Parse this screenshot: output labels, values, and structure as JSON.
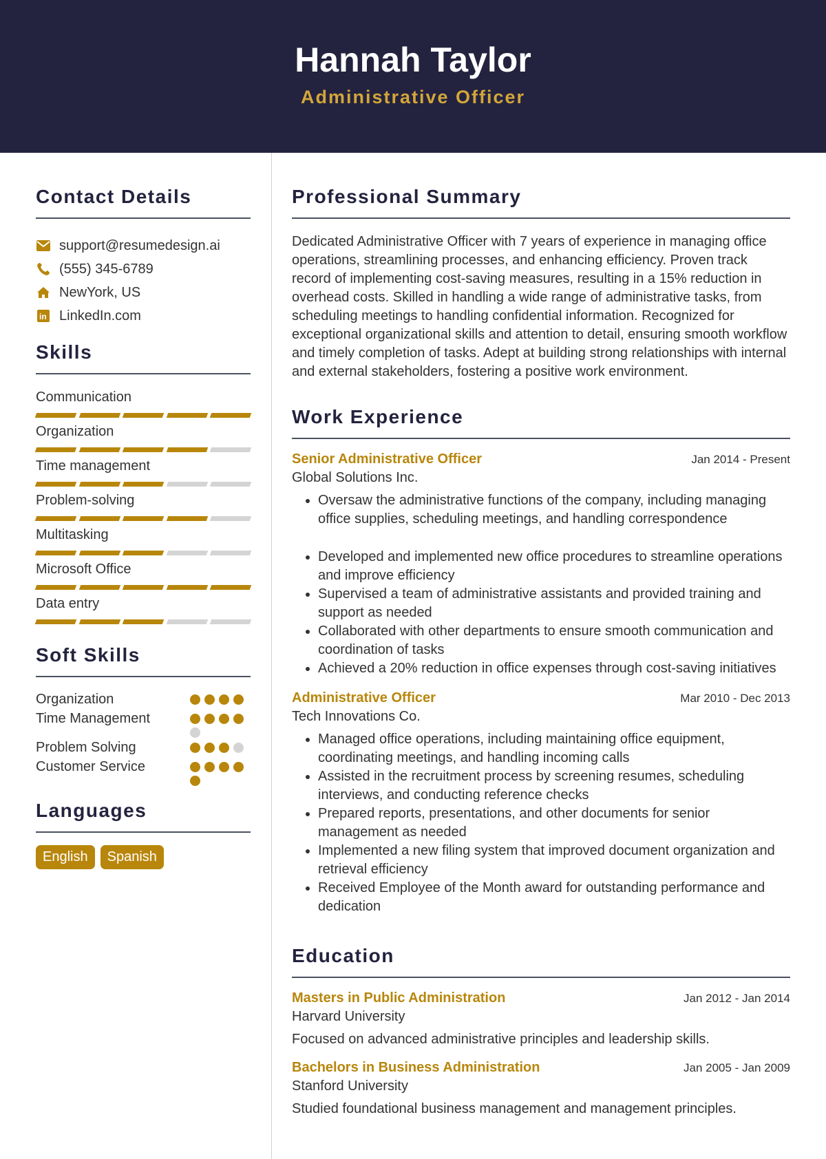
{
  "header": {
    "name": "Hannah Taylor",
    "role": "Administrative Officer"
  },
  "colors": {
    "header_bg": "#23233f",
    "accent": "#b8860b",
    "role_text": "#d4a63a",
    "inactive": "#d4d4d4"
  },
  "contact": {
    "title": "Contact Details",
    "items": [
      {
        "icon": "envelope-icon",
        "text": "support@resumedesign.ai"
      },
      {
        "icon": "phone-icon",
        "text": "(555) 345-6789"
      },
      {
        "icon": "home-icon",
        "text": "NewYork, US"
      },
      {
        "icon": "linkedin-icon",
        "text": "LinkedIn.com"
      }
    ]
  },
  "skills": {
    "title": "Skills",
    "items": [
      {
        "name": "Communication",
        "level": 5,
        "max": 5
      },
      {
        "name": "Organization",
        "level": 4,
        "max": 5
      },
      {
        "name": "Time management",
        "level": 3,
        "max": 5
      },
      {
        "name": "Problem-solving",
        "level": 4,
        "max": 5
      },
      {
        "name": "Multitasking",
        "level": 3,
        "max": 5
      },
      {
        "name": "Microsoft Office",
        "level": 5,
        "max": 5
      },
      {
        "name": "Data entry",
        "level": 3,
        "max": 5
      }
    ]
  },
  "soft_skills": {
    "title": "Soft Skills",
    "items": [
      {
        "name": "Organization",
        "level": 4,
        "max": 4
      },
      {
        "name": "Time Management",
        "level": 4,
        "max": 5
      },
      {
        "name": "Problem Solving",
        "level": 3,
        "max": 4
      },
      {
        "name": "Customer Service",
        "level": 5,
        "max": 5
      }
    ]
  },
  "languages": {
    "title": "Languages",
    "items": [
      "English",
      "Spanish"
    ]
  },
  "summary": {
    "title": "Professional Summary",
    "text": "Dedicated Administrative Officer with 7 years of experience in managing office operations, streamlining processes, and enhancing efficiency. Proven track record of implementing cost-saving measures, resulting in a 15% reduction in overhead costs. Skilled in handling a wide range of administrative tasks, from scheduling meetings to handling confidential information. Recognized for exceptional organizational skills and attention to detail, ensuring smooth workflow and timely completion of tasks. Adept at building strong relationships with internal and external stakeholders, fostering a positive work environment."
  },
  "experience": {
    "title": "Work Experience",
    "jobs": [
      {
        "title": "Senior Administrative Officer",
        "dates": "Jan 2014 - Present",
        "org": "Global Solutions Inc.",
        "bullets": [
          "Oversaw the administrative functions of the company, including managing office supplies, scheduling meetings, and handling correspondence",
          "Developed and implemented new office procedures to streamline operations and improve efficiency",
          "Supervised a team of administrative assistants and provided training and support as needed",
          "Collaborated with other departments to ensure smooth communication and coordination of tasks",
          "Achieved a 20% reduction in office expenses through cost-saving initiatives"
        ]
      },
      {
        "title": "Administrative Officer",
        "dates": "Mar 2010 - Dec 2013",
        "org": "Tech Innovations Co.",
        "bullets": [
          "Managed office operations, including maintaining office equipment, coordinating meetings, and handling incoming calls",
          "Assisted in the recruitment process by screening resumes, scheduling interviews, and conducting reference checks",
          "Prepared reports, presentations, and other documents for senior management as needed",
          "Implemented a new filing system that improved document organization and retrieval efficiency",
          "Received Employee of the Month award for outstanding performance and dedication"
        ]
      }
    ]
  },
  "education": {
    "title": "Education",
    "items": [
      {
        "degree": "Masters in Public Administration",
        "dates": "Jan 2012 - Jan 2014",
        "school": "Harvard University",
        "desc": "Focused on advanced administrative principles and leadership skills."
      },
      {
        "degree": "Bachelors in Business Administration",
        "dates": "Jan 2005 - Jan 2009",
        "school": "Stanford University",
        "desc": "Studied foundational business management and management principles."
      }
    ]
  }
}
